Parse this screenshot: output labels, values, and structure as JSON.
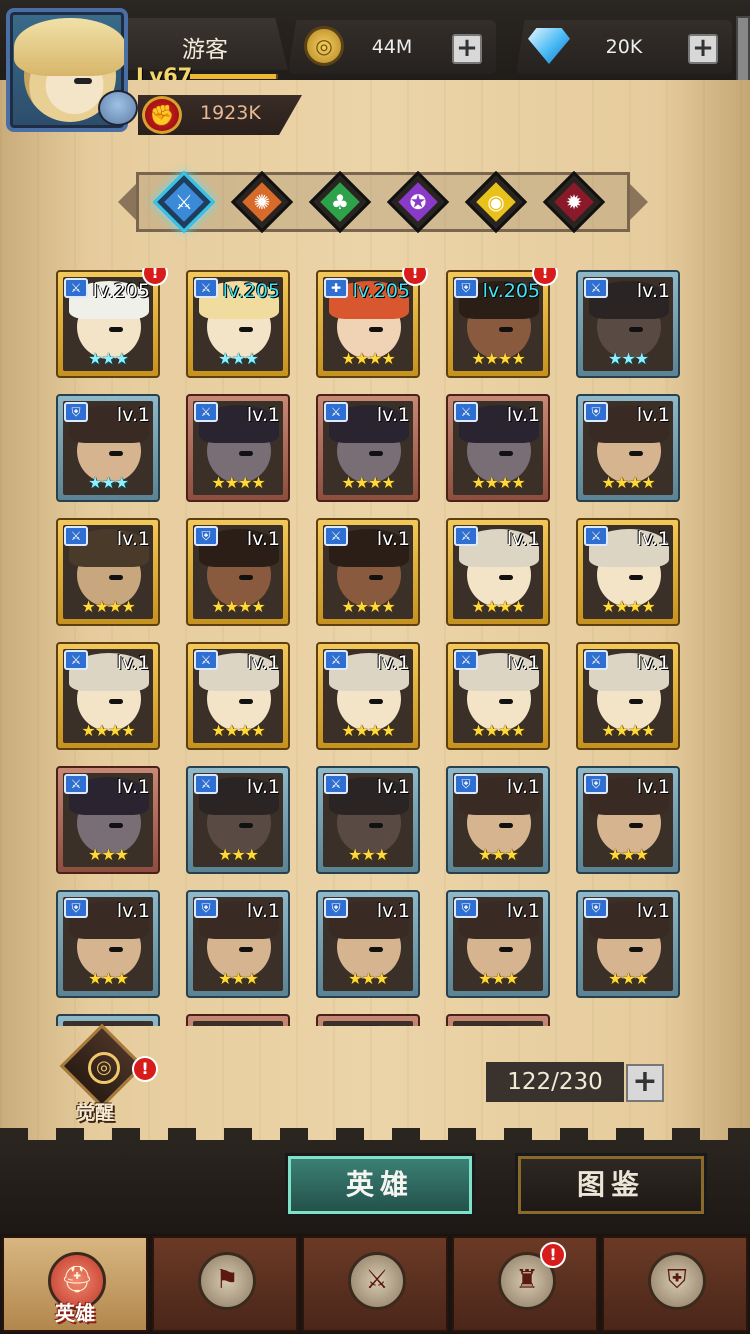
{
  "player": {
    "name": "游客",
    "level": "Lv67",
    "xp_fraction": 0.98,
    "power": "1923K"
  },
  "currencies": {
    "gold": "44M",
    "gems": "20K",
    "plus": "+"
  },
  "factions": [
    {
      "icon": "blade-icon",
      "glyph": "⚔",
      "color": "#3a8ad8",
      "selected": true
    },
    {
      "icon": "sun-icon",
      "glyph": "✺",
      "color": "#d86a2a",
      "selected": false
    },
    {
      "icon": "clover-icon",
      "glyph": "♣",
      "color": "#2ea24a",
      "selected": false
    },
    {
      "icon": "spiral-icon",
      "glyph": "✪",
      "color": "#8a3ac8",
      "selected": false
    },
    {
      "icon": "eye-icon",
      "glyph": "◉",
      "color": "#e8c21a",
      "selected": false
    },
    {
      "icon": "demon-icon",
      "glyph": "✹",
      "color": "#8a1a2a",
      "selected": false
    }
  ],
  "heroes": [
    {
      "level": "lv.205",
      "frame": "gold",
      "stars": "★★★",
      "star_color": "cyan",
      "level_color": "white",
      "alert": "!",
      "role": "sword",
      "skin": "#f3e3c7",
      "hair": "#f0f0ea"
    },
    {
      "level": "lv.205",
      "frame": "gold",
      "stars": "★★★",
      "star_color": "cyan",
      "level_color": "cyan",
      "alert": "",
      "role": "sword",
      "skin": "#f3e3c7",
      "hair": "#f1dca0"
    },
    {
      "level": "lv.205",
      "frame": "gold",
      "stars": "★★★★",
      "star_color": "gold",
      "level_color": "cyan",
      "alert": "!",
      "role": "plus",
      "skin": "#f0d2b4",
      "hair": "#d9572e"
    },
    {
      "level": "lv.205",
      "frame": "gold",
      "stars": "★★★★",
      "star_color": "gold",
      "level_color": "cyan",
      "alert": "!",
      "role": "shield",
      "skin": "#8a5a3e",
      "hair": "#2a1e16"
    },
    {
      "level": "lv.1",
      "frame": "blue",
      "stars": "★★★",
      "star_color": "cyan",
      "level_color": "white",
      "alert": "",
      "role": "sword",
      "skin": "#5a4a44",
      "hair": "#2a2424"
    },
    {
      "level": "lv.1",
      "frame": "blue",
      "stars": "★★★",
      "star_color": "cyan",
      "level_color": "white",
      "alert": "",
      "role": "shield",
      "skin": "#d6b490",
      "hair": "#3a2a24"
    },
    {
      "level": "lv.1",
      "frame": "red",
      "stars": "★★★★",
      "star_color": "gold",
      "level_color": "white",
      "alert": "",
      "role": "sword",
      "skin": "#7a6e76",
      "hair": "#2a2430"
    },
    {
      "level": "lv.1",
      "frame": "red",
      "stars": "★★★★",
      "star_color": "gold",
      "level_color": "white",
      "alert": "",
      "role": "sword",
      "skin": "#7a6e76",
      "hair": "#2a2430"
    },
    {
      "level": "lv.1",
      "frame": "red",
      "stars": "★★★★",
      "star_color": "gold",
      "level_color": "white",
      "alert": "",
      "role": "sword",
      "skin": "#7a6e76",
      "hair": "#2a2430"
    },
    {
      "level": "lv.1",
      "frame": "blue",
      "stars": "★★★★",
      "star_color": "gold",
      "level_color": "white",
      "alert": "",
      "role": "shield",
      "skin": "#d6b490",
      "hair": "#3a2a24"
    },
    {
      "level": "lv.1",
      "frame": "gold",
      "stars": "★★★★",
      "star_color": "gold",
      "level_color": "white",
      "alert": "",
      "role": "sword",
      "skin": "#c9a77e",
      "hair": "#4a3a2a"
    },
    {
      "level": "lv.1",
      "frame": "gold",
      "stars": "★★★★",
      "star_color": "gold",
      "level_color": "white",
      "alert": "",
      "role": "shield",
      "skin": "#8a5a3e",
      "hair": "#2a1e16"
    },
    {
      "level": "lv.1",
      "frame": "gold",
      "stars": "★★★★",
      "star_color": "gold",
      "level_color": "white",
      "alert": "",
      "role": "sword",
      "skin": "#8a5a3e",
      "hair": "#2a1e16"
    },
    {
      "level": "lv.1",
      "frame": "gold",
      "stars": "★★★★",
      "star_color": "gold",
      "level_color": "white",
      "alert": "",
      "role": "sword",
      "skin": "#f3e3c7",
      "hair": "#ddd5c4"
    },
    {
      "level": "lv.1",
      "frame": "gold",
      "stars": "★★★★",
      "star_color": "gold",
      "level_color": "white",
      "alert": "",
      "role": "sword",
      "skin": "#f3e3c7",
      "hair": "#ddd5c4"
    },
    {
      "level": "lv.1",
      "frame": "gold",
      "stars": "★★★★",
      "star_color": "gold",
      "level_color": "white",
      "alert": "",
      "role": "sword",
      "skin": "#f3e3c7",
      "hair": "#ddd5c4"
    },
    {
      "level": "lv.1",
      "frame": "gold",
      "stars": "★★★★",
      "star_color": "gold",
      "level_color": "white",
      "alert": "",
      "role": "sword",
      "skin": "#f3e3c7",
      "hair": "#ddd5c4"
    },
    {
      "level": "lv.1",
      "frame": "gold",
      "stars": "★★★★",
      "star_color": "gold",
      "level_color": "white",
      "alert": "",
      "role": "sword",
      "skin": "#f3e3c7",
      "hair": "#ddd5c4"
    },
    {
      "level": "lv.1",
      "frame": "gold",
      "stars": "★★★★",
      "star_color": "gold",
      "level_color": "white",
      "alert": "",
      "role": "sword",
      "skin": "#f3e3c7",
      "hair": "#ddd5c4"
    },
    {
      "level": "lv.1",
      "frame": "gold",
      "stars": "★★★★",
      "star_color": "gold",
      "level_color": "white",
      "alert": "",
      "role": "sword",
      "skin": "#f3e3c7",
      "hair": "#ddd5c4"
    },
    {
      "level": "lv.1",
      "frame": "red",
      "stars": "★★★",
      "star_color": "gold",
      "level_color": "white",
      "alert": "",
      "role": "sword",
      "skin": "#7a6e76",
      "hair": "#2a2430"
    },
    {
      "level": "lv.1",
      "frame": "blue",
      "stars": "★★★",
      "star_color": "gold",
      "level_color": "white",
      "alert": "",
      "role": "sword",
      "skin": "#5a4a44",
      "hair": "#2a2424"
    },
    {
      "level": "lv.1",
      "frame": "blue",
      "stars": "★★★",
      "star_color": "gold",
      "level_color": "white",
      "alert": "",
      "role": "sword",
      "skin": "#5a4a44",
      "hair": "#2a2424"
    },
    {
      "level": "lv.1",
      "frame": "blue",
      "stars": "★★★",
      "star_color": "gold",
      "level_color": "white",
      "alert": "",
      "role": "shield",
      "skin": "#d6b490",
      "hair": "#3a2a24"
    },
    {
      "level": "lv.1",
      "frame": "blue",
      "stars": "★★★",
      "star_color": "gold",
      "level_color": "white",
      "alert": "",
      "role": "shield",
      "skin": "#d6b490",
      "hair": "#3a2a24"
    },
    {
      "level": "lv.1",
      "frame": "blue",
      "stars": "★★★",
      "star_color": "gold",
      "level_color": "white",
      "alert": "",
      "role": "shield",
      "skin": "#d6b490",
      "hair": "#3a2a24"
    },
    {
      "level": "lv.1",
      "frame": "blue",
      "stars": "★★★",
      "star_color": "gold",
      "level_color": "white",
      "alert": "",
      "role": "shield",
      "skin": "#d6b490",
      "hair": "#3a2a24"
    },
    {
      "level": "lv.1",
      "frame": "blue",
      "stars": "★★★",
      "star_color": "gold",
      "level_color": "white",
      "alert": "",
      "role": "shield",
      "skin": "#d6b490",
      "hair": "#3a2a24"
    },
    {
      "level": "lv.1",
      "frame": "blue",
      "stars": "★★★",
      "star_color": "gold",
      "level_color": "white",
      "alert": "",
      "role": "shield",
      "skin": "#d6b490",
      "hair": "#3a2a24"
    },
    {
      "level": "lv.1",
      "frame": "blue",
      "stars": "★★★",
      "star_color": "gold",
      "level_color": "white",
      "alert": "",
      "role": "shield",
      "skin": "#d6b490",
      "hair": "#3a2a24"
    },
    {
      "level": "",
      "frame": "blue",
      "stars": "",
      "star_color": "gold",
      "level_color": "white",
      "alert": "",
      "role": "",
      "skin": "#d6b490",
      "hair": "#3a2a24"
    },
    {
      "level": "",
      "frame": "red",
      "stars": "",
      "star_color": "gold",
      "level_color": "white",
      "alert": "",
      "role": "",
      "skin": "#7a6e76",
      "hair": "#2a2430"
    },
    {
      "level": "",
      "frame": "red",
      "stars": "",
      "star_color": "gold",
      "level_color": "white",
      "alert": "",
      "role": "",
      "skin": "#7a6e76",
      "hair": "#2a2430"
    },
    {
      "level": "",
      "frame": "red",
      "stars": "",
      "star_color": "gold",
      "level_color": "white",
      "alert": "",
      "role": "",
      "skin": "#7a6e76",
      "hair": "#2a2430"
    }
  ],
  "awaken": {
    "label": "觉醒",
    "alert": "!"
  },
  "hero_count": {
    "value": "122/230",
    "plus": "+"
  },
  "view_tabs": {
    "heroes": "英雄",
    "codex": "图鉴"
  },
  "bottom_nav": [
    {
      "label": "英雄",
      "icon": "helmet-icon",
      "glyph": "⛑",
      "active": true,
      "alert": ""
    },
    {
      "label": "",
      "icon": "flag-icon",
      "glyph": "⚑",
      "active": false,
      "alert": ""
    },
    {
      "label": "",
      "icon": "crossed-swords-icon",
      "glyph": "⚔",
      "active": false,
      "alert": ""
    },
    {
      "label": "",
      "icon": "castle-icon",
      "glyph": "♜",
      "active": false,
      "alert": "!"
    },
    {
      "label": "",
      "icon": "guild-shield-icon",
      "glyph": "⛨",
      "active": false,
      "alert": ""
    }
  ]
}
